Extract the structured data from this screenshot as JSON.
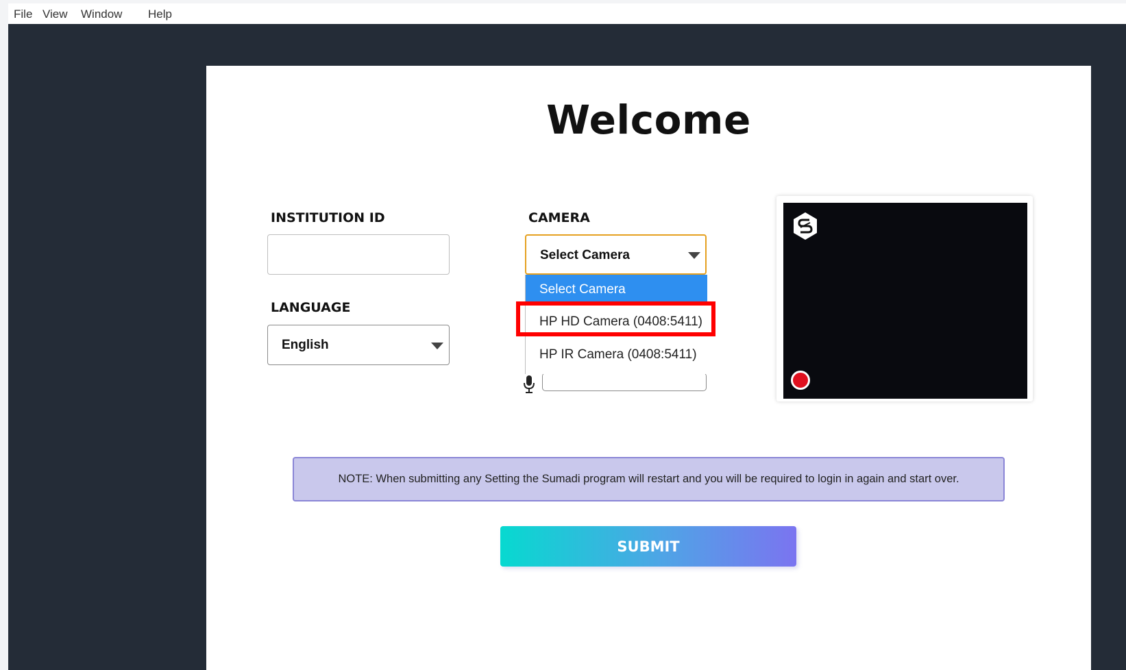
{
  "menu": {
    "items": [
      "File",
      "View",
      "Window",
      "Help"
    ]
  },
  "page": {
    "title": "Welcome"
  },
  "institution": {
    "label": "INSTITUTION ID",
    "value": ""
  },
  "language": {
    "label": "LANGUAGE",
    "selected": "English"
  },
  "camera": {
    "label": "CAMERA",
    "selected": "Select Camera",
    "options": [
      "Select Camera",
      "HP HD Camera (0408:5411)",
      "HP IR Camera (0408:5411)"
    ],
    "highlighted_option": "HP HD Camera (0408:5411)"
  },
  "microphone": {
    "value": ""
  },
  "preview": {
    "logo_icon": "sumadi-logo-icon",
    "record_icon": "record-indicator-icon",
    "colors": {
      "record": "#e0101e",
      "video_bg": "#090a0f"
    }
  },
  "note": {
    "text": "NOTE: When submitting any Setting the Sumadi program will restart and you will be required to login in again and start over."
  },
  "submit": {
    "label": "SUBMIT"
  },
  "colors": {
    "app_background": "#242c37",
    "note_background": "#c9c8ec",
    "dropdown_selected": "#2e8ff0",
    "highlight": "#ff0000",
    "camera_focus_border": "#e5a01f"
  }
}
